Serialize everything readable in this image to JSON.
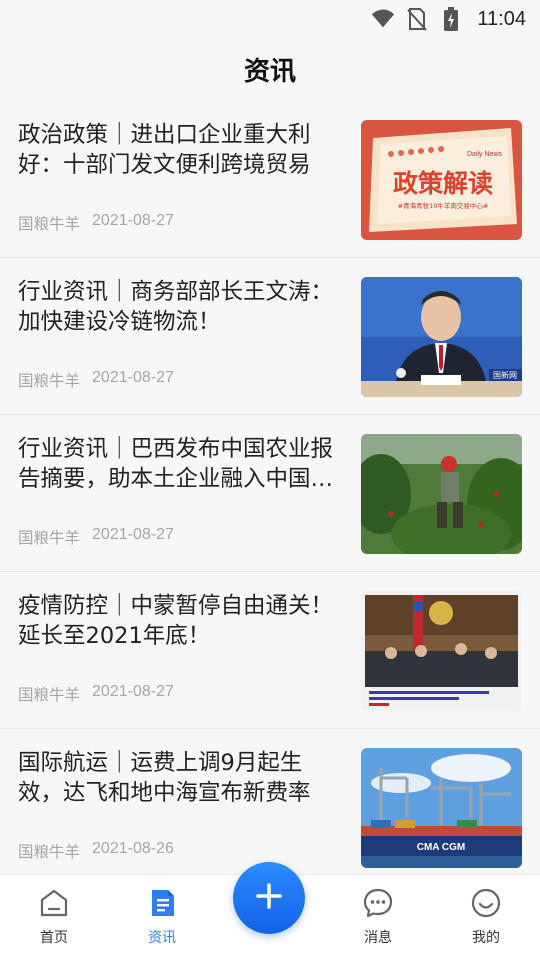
{
  "status_bar": {
    "time": "11:04",
    "icons": [
      "wifi-icon",
      "no-sim-icon",
      "battery-charging-icon"
    ]
  },
  "header": {
    "title": "资讯"
  },
  "articles": [
    {
      "title": "政治政策｜进出口企业重大利好：十部门发文便利跨境贸易",
      "source": "国粮牛羊",
      "date": "2021-08-27",
      "thumb_text": "政策解读",
      "thumb_sub": "#青海青牧10牛羊肉交易中心#",
      "thumb_tag": "Daily News"
    },
    {
      "title": "行业资讯｜商务部部长王文涛：加快建设冷链物流！",
      "source": "国粮牛羊",
      "date": "2021-08-27",
      "thumb_tag": "国新网"
    },
    {
      "title": "行业资讯｜巴西发布中国农业报告摘要，助本土企业融入中国市场",
      "source": "国粮牛羊",
      "date": "2021-08-27"
    },
    {
      "title": "疫情防控｜中蒙暂停自由通关！延长至2021年底！",
      "source": "国粮牛羊",
      "date": "2021-08-27"
    },
    {
      "title": "国际航运｜运费上调9月起生效，达飞和地中海宣布新费率",
      "source": "国粮牛羊",
      "date": "2021-08-26",
      "thumb_tag": "CMA CGM"
    }
  ],
  "tabbar": {
    "items": [
      {
        "label": "首页",
        "icon": "home-icon"
      },
      {
        "label": "资讯",
        "icon": "news-icon",
        "active": true
      },
      {
        "label": "消息",
        "icon": "message-icon"
      },
      {
        "label": "我的",
        "icon": "profile-icon"
      }
    ],
    "fab_icon": "plus-icon"
  },
  "colors": {
    "accent": "#2f7ef0",
    "meta_text": "#a6a6a6",
    "background": "#f7f7f7"
  }
}
